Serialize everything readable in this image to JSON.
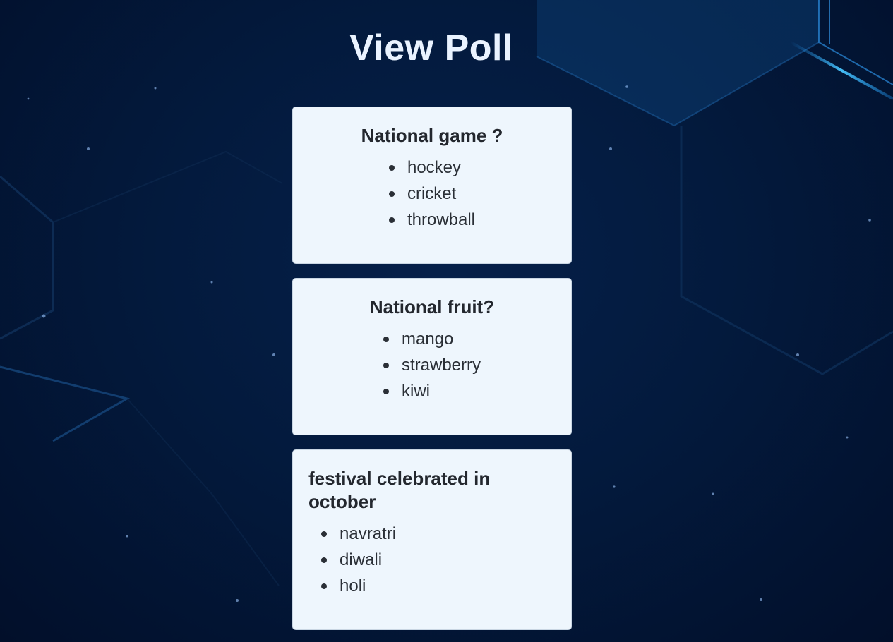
{
  "page": {
    "title": "View Poll"
  },
  "polls": [
    {
      "question": "National game ?",
      "options": [
        "hockey",
        "cricket",
        "throwball"
      ]
    },
    {
      "question": "National fruit?",
      "options": [
        "mango",
        "strawberry",
        "kiwi"
      ]
    },
    {
      "question": "festival celebrated in october",
      "options": [
        "navratri",
        "diwali",
        "holi"
      ]
    }
  ],
  "colors": {
    "background": "#031a3d",
    "card": "#eef6fd",
    "title": "#eaf3ff",
    "text": "#23272e",
    "accent_glow": "#1e9bff"
  }
}
